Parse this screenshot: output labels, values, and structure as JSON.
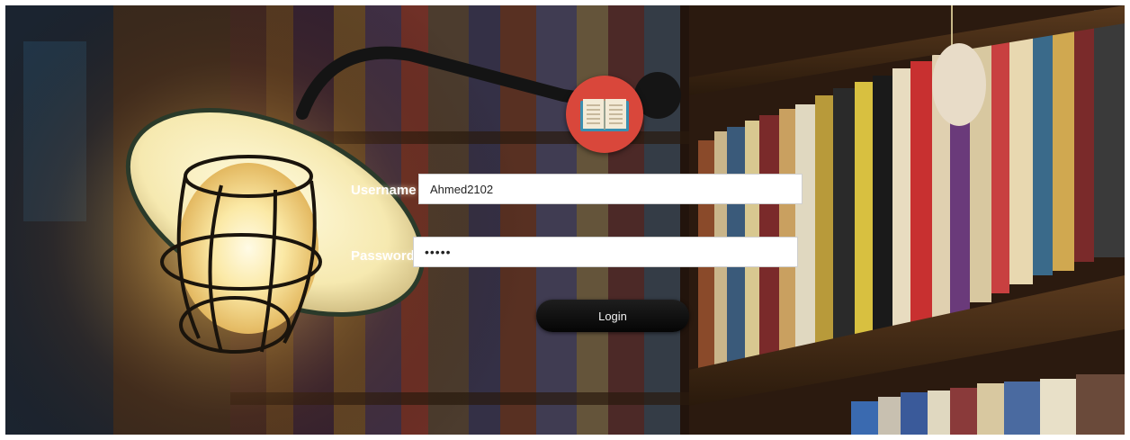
{
  "form": {
    "username_label": "Username",
    "username_value": "Ahmed2102",
    "password_label": "Password",
    "password_value": "•••••",
    "login_label": "Login"
  },
  "logo": {
    "icon": "open-book-icon",
    "color": "#d9473b"
  },
  "background": {
    "description_icon": "library-lamp-bookshelf-image"
  }
}
